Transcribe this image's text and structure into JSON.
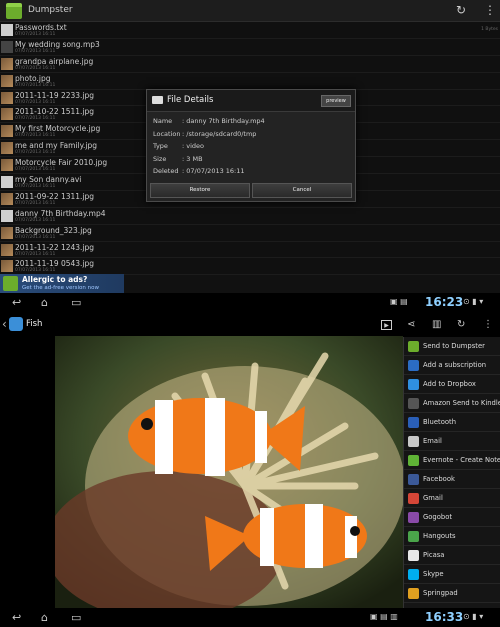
{
  "dumpster": {
    "title": "Dumpster",
    "files": [
      {
        "name": "Passwords.txt",
        "date": "07/07/2013 16:11",
        "size": "1 Bytes",
        "thumb": "doc"
      },
      {
        "name": "My wedding song.mp3",
        "date": "07/07/2013 16:11",
        "size": "",
        "thumb": "music"
      },
      {
        "name": "grandpa airplane.jpg",
        "date": "07/07/2013 16:11",
        "size": "",
        "thumb": "img"
      },
      {
        "name": "photo.jpg",
        "date": "07/07/2013 16:11",
        "size": "",
        "thumb": "img"
      },
      {
        "name": "2011-11-19 2233.jpg",
        "date": "07/07/2013 16:11",
        "size": "",
        "thumb": "img"
      },
      {
        "name": "2011-10-22 1511.jpg",
        "date": "07/07/2013 16:11",
        "size": "",
        "thumb": "img"
      },
      {
        "name": "My first Motorcycle.jpg",
        "date": "07/07/2013 16:11",
        "size": "",
        "thumb": "img"
      },
      {
        "name": "me and my Family.jpg",
        "date": "07/07/2013 16:11",
        "size": "",
        "thumb": "img"
      },
      {
        "name": "Motorcycle Fair 2010.jpg",
        "date": "07/07/2013 16:11",
        "size": "",
        "thumb": "img"
      },
      {
        "name": "my Son danny.avi",
        "date": "07/07/2013 16:11",
        "size": "",
        "thumb": "doc"
      },
      {
        "name": "2011-09-22 1311.jpg",
        "date": "07/07/2013 16:11",
        "size": "",
        "thumb": "img"
      },
      {
        "name": "danny 7th Birthday.mp4",
        "date": "07/07/2013 16:11",
        "size": "",
        "thumb": "doc"
      },
      {
        "name": "Background_323.jpg",
        "date": "07/07/2013 16:11",
        "size": "",
        "thumb": "img"
      },
      {
        "name": "2011-11-22 1243.jpg",
        "date": "07/07/2013 16:11",
        "size": "",
        "thumb": "img"
      },
      {
        "name": "2011-11-19 0543.jpg",
        "date": "07/07/2013 16:11",
        "size": "",
        "thumb": "img"
      }
    ],
    "ad": {
      "title": "Allergic to ads?",
      "subtitle": "Get the ad-free version now"
    },
    "dialog": {
      "title": "File Details",
      "preview": "preview",
      "rows": [
        {
          "key": "Name",
          "value": ": danny 7th Birthday.mp4"
        },
        {
          "key": "Location",
          "value": ": /storage/sdcard0/tmp"
        },
        {
          "key": "Type",
          "value": ": video"
        },
        {
          "key": "Size",
          "value": ": 3 MB"
        },
        {
          "key": "Deleted",
          "value": ": 07/07/2013 16:11"
        }
      ],
      "restore": "Restore",
      "cancel": "Cancel"
    },
    "clock": "16:23"
  },
  "gallery": {
    "title": "Fish",
    "share_items": [
      {
        "label": "Send to Dumpster",
        "icon": "dumpster-icon",
        "color": "#6cad2c"
      },
      {
        "label": "Add a subscription",
        "icon": "subscription-icon",
        "color": "#2b6cc4"
      },
      {
        "label": "Add to Dropbox",
        "icon": "dropbox-icon",
        "color": "#2f8fe0"
      },
      {
        "label": "Amazon Send to Kindle",
        "icon": "kindle-icon",
        "color": "#555555"
      },
      {
        "label": "Bluetooth",
        "icon": "bluetooth-icon",
        "color": "#2a5fb8"
      },
      {
        "label": "Email",
        "icon": "email-icon",
        "color": "#c8c8c8"
      },
      {
        "label": "Evernote - Create Note",
        "icon": "evernote-icon",
        "color": "#5fb336"
      },
      {
        "label": "Facebook",
        "icon": "facebook-icon",
        "color": "#3b5998"
      },
      {
        "label": "Gmail",
        "icon": "gmail-icon",
        "color": "#d44637"
      },
      {
        "label": "Gogobot",
        "icon": "gogobot-icon",
        "color": "#8a4aa8"
      },
      {
        "label": "Hangouts",
        "icon": "hangouts-icon",
        "color": "#4aa44a"
      },
      {
        "label": "Picasa",
        "icon": "picasa-icon",
        "color": "#e8e8e8"
      },
      {
        "label": "Skype",
        "icon": "skype-icon",
        "color": "#00aff0"
      },
      {
        "label": "Springpad",
        "icon": "springpad-icon",
        "color": "#e0a020"
      }
    ],
    "clock": "16:33"
  }
}
